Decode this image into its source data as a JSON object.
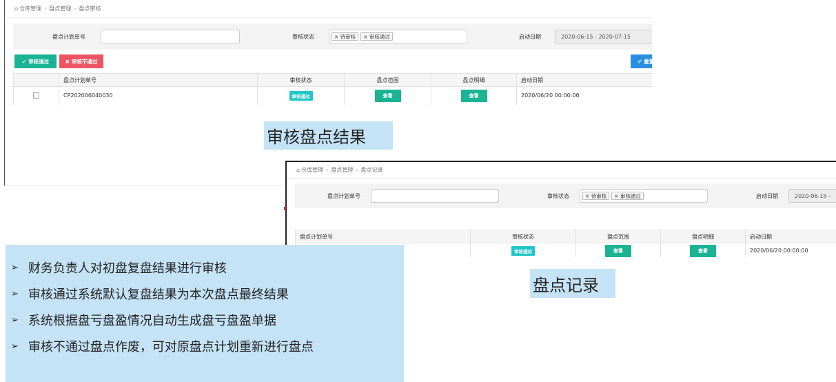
{
  "top_screen": {
    "breadcrumb": [
      "仓库管理",
      "盘点管理",
      "盘点审核"
    ],
    "filter": {
      "plan_no_label": "盘点计划单号",
      "plan_no_value": "",
      "status_label": "审核状态",
      "status_tags": [
        "× 待审核",
        "× 审核通过"
      ],
      "date_label": "启动日期",
      "date_range": "2020-06-15 - 2020-07-15"
    },
    "buttons": {
      "pass": "审核通过",
      "reject": "审核不通过",
      "reset": "重置"
    },
    "table": {
      "headers": [
        "",
        "盘点计划单号",
        "审核状态",
        "盘点范围",
        "盘点明细",
        "启动日期"
      ],
      "rows": [
        {
          "plan_no": "CP202006040030",
          "status": "审核通过",
          "range_btn": "查看",
          "detail_btn": "查看",
          "date": "2020/06/20 00:00:00"
        }
      ]
    }
  },
  "bottom_screen": {
    "breadcrumb": [
      "仓库管理",
      "盘点管理",
      "盘点记录"
    ],
    "filter": {
      "plan_no_label": "盘点计划单号",
      "plan_no_value": "",
      "status_label": "审核状态",
      "status_tags": [
        "× 待审核",
        "× 审核通过"
      ],
      "date_label": "启动日期",
      "date_range": "2020-06-15 - "
    },
    "table": {
      "headers": [
        "盘点计划单号",
        "审核状态",
        "盘点范围",
        "盘点明细",
        "启动日期"
      ],
      "rows": [
        {
          "plan_no": "",
          "status": "审核通过",
          "range_btn": "查看",
          "detail_btn": "查看",
          "date": "2020/06/20 00:00:00"
        }
      ]
    }
  },
  "captions": {
    "audit_result": "审核盘点结果",
    "record": "盘点记录"
  },
  "notes": [
    "财务负责人对初盘复盘结果进行审核",
    "审核通过系统默认复盘结果为本次盘点最终结果",
    "系统根据盘亏盘盈情况自动生成盘亏盘盈单据",
    "审核不通过盘点作废，可对原盘点计划重新进行盘点"
  ],
  "colors": {
    "success": "#1ab394",
    "danger": "#ed5565",
    "primary": "#2b8fe0",
    "info_badge": "#23c6c8",
    "caption_bg": "#c5e3f6"
  }
}
